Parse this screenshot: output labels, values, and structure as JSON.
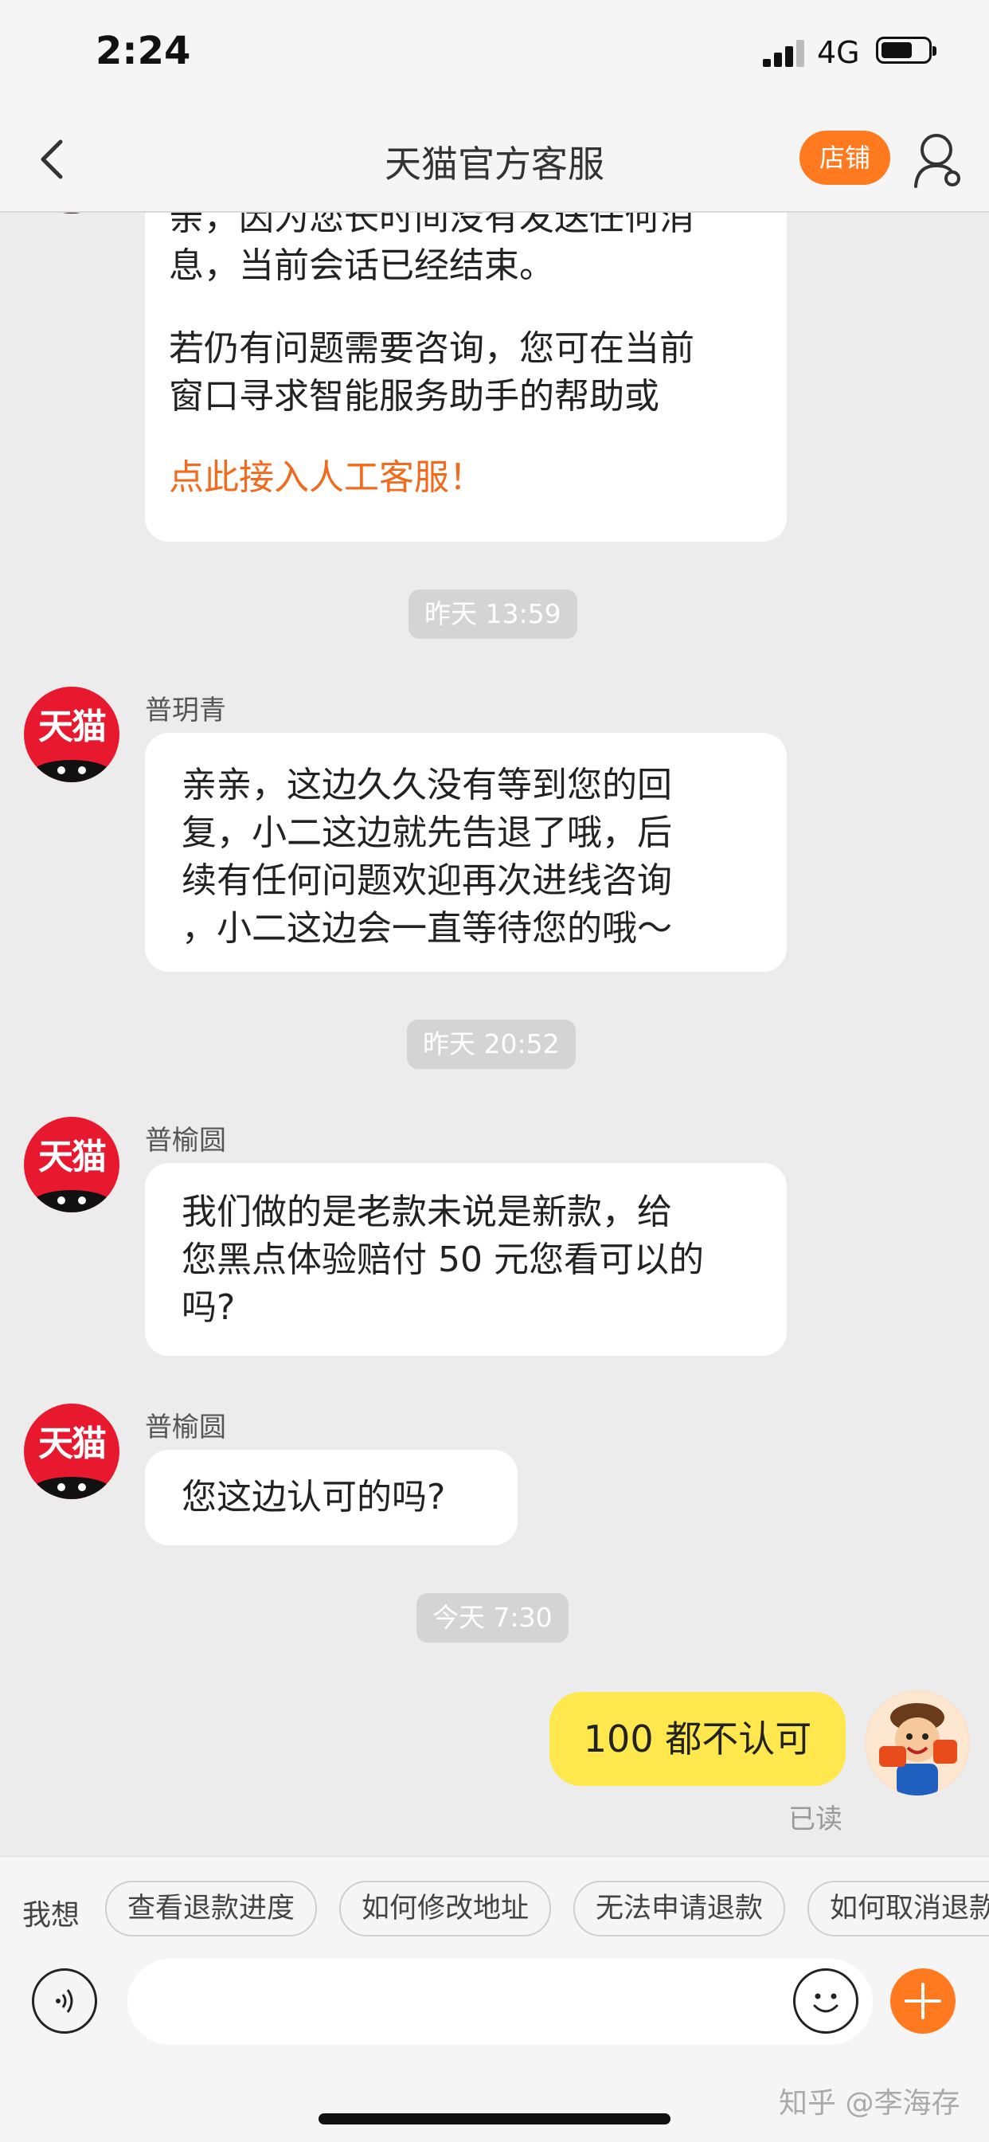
{
  "status_bar": {
    "time": "2:24",
    "network": "4G"
  },
  "header": {
    "title": "天猫官方客服",
    "store_button": "店铺"
  },
  "messages": {
    "first": {
      "line1": "亲，因为您长时间没有发送任何消",
      "line2": "息，当前会话已经结束。",
      "line3": "若仍有问题需要咨询，您可在当前",
      "line4": "窗口寻求智能服务助手的帮助或",
      "link": "点此接入人工客服！"
    },
    "ts1": "昨天 13:59",
    "second": {
      "sender": "普玥青",
      "avatar_text": "天猫",
      "line1": "亲亲，这边久久没有等到您的回",
      "line2": "复，小二这边就先告退了哦，后",
      "line3": "续有任何问题欢迎再次进线咨询",
      "line4": "，小二这边会一直等待您的哦～"
    },
    "ts2": "昨天 20:52",
    "third": {
      "sender": "普榆圆",
      "avatar_text": "天猫",
      "line1": "我们做的是老款未说是新款，给",
      "line2": "您黑点体验赔付 50 元您看可以的",
      "line3": "吗?"
    },
    "fourth": {
      "sender": "普榆圆",
      "avatar_text": "天猫",
      "line1": "您这边认可的吗?"
    },
    "ts3": "今天 7:30",
    "own": {
      "text": "100 都不认可",
      "status": "已读"
    }
  },
  "bottom_bar": {
    "prompt_label": "我想",
    "quick_replies": [
      "查看退款进度",
      "如何修改地址",
      "无法申请退款",
      "如何取消退款"
    ],
    "watermark": "知乎 @李海存"
  }
}
